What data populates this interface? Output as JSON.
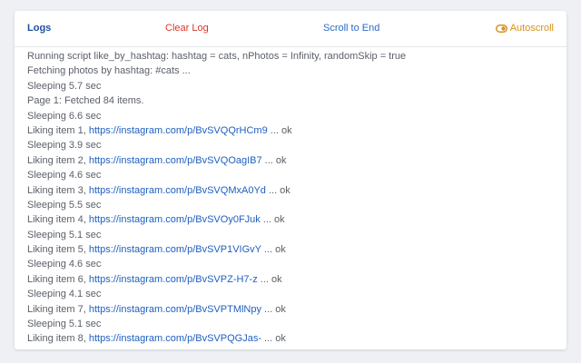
{
  "toolbar": {
    "logs_label": "Logs",
    "clear_label": "Clear Log",
    "scroll_label": "Scroll to End",
    "autoscroll_label": "Autoscroll"
  },
  "log_lines": [
    {
      "text": "Running script like_by_hashtag: hashtag = cats, nPhotos = Infinity, randomSkip = true"
    },
    {
      "text": "Fetching photos by hashtag: #cats ..."
    },
    {
      "text": "Sleeping 5.7 sec"
    },
    {
      "text": "Page 1: Fetched 84 items."
    },
    {
      "text": "Sleeping 6.6 sec"
    },
    {
      "prefix": "Liking item 1, ",
      "link": "https://instagram.com/p/BvSVQQrHCm9",
      "suffix": " ... ok"
    },
    {
      "text": "Sleeping 3.9 sec"
    },
    {
      "prefix": "Liking item 2, ",
      "link": "https://instagram.com/p/BvSVQOagIB7",
      "suffix": " ... ok"
    },
    {
      "text": "Sleeping 4.6 sec"
    },
    {
      "prefix": "Liking item 3, ",
      "link": "https://instagram.com/p/BvSVQMxA0Yd",
      "suffix": " ... ok"
    },
    {
      "text": "Sleeping 5.5 sec"
    },
    {
      "prefix": "Liking item 4, ",
      "link": "https://instagram.com/p/BvSVOy0FJuk",
      "suffix": " ... ok"
    },
    {
      "text": "Sleeping 5.1 sec"
    },
    {
      "prefix": "Liking item 5, ",
      "link": "https://instagram.com/p/BvSVP1VIGvY",
      "suffix": " ... ok"
    },
    {
      "text": "Sleeping 4.6 sec"
    },
    {
      "prefix": "Liking item 6, ",
      "link": "https://instagram.com/p/BvSVPZ-H7-z",
      "suffix": " ... ok"
    },
    {
      "text": "Sleeping 4.1 sec"
    },
    {
      "prefix": "Liking item 7, ",
      "link": "https://instagram.com/p/BvSVPTMlNpy",
      "suffix": " ... ok"
    },
    {
      "text": "Sleeping 5.1 sec"
    },
    {
      "prefix": "Liking item 8, ",
      "link": "https://instagram.com/p/BvSVPQGJas-",
      "suffix": " ... ok"
    }
  ]
}
